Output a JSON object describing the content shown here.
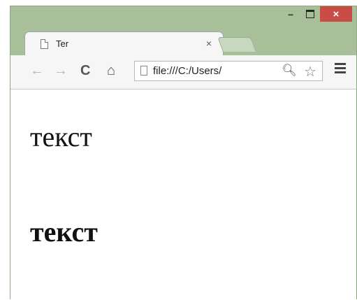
{
  "window": {
    "controls": {
      "minimize": "–",
      "maximize": "□",
      "close": "×"
    }
  },
  "tab": {
    "title": "Ter",
    "close": "×"
  },
  "toolbar": {
    "back": "←",
    "forward": "→",
    "reload": "C",
    "home": "⌂",
    "url": "file:///C:/Users/",
    "zoom": "🔍︎",
    "star": "☆"
  },
  "page": {
    "text_normal": "текст",
    "text_bold": "текст"
  }
}
